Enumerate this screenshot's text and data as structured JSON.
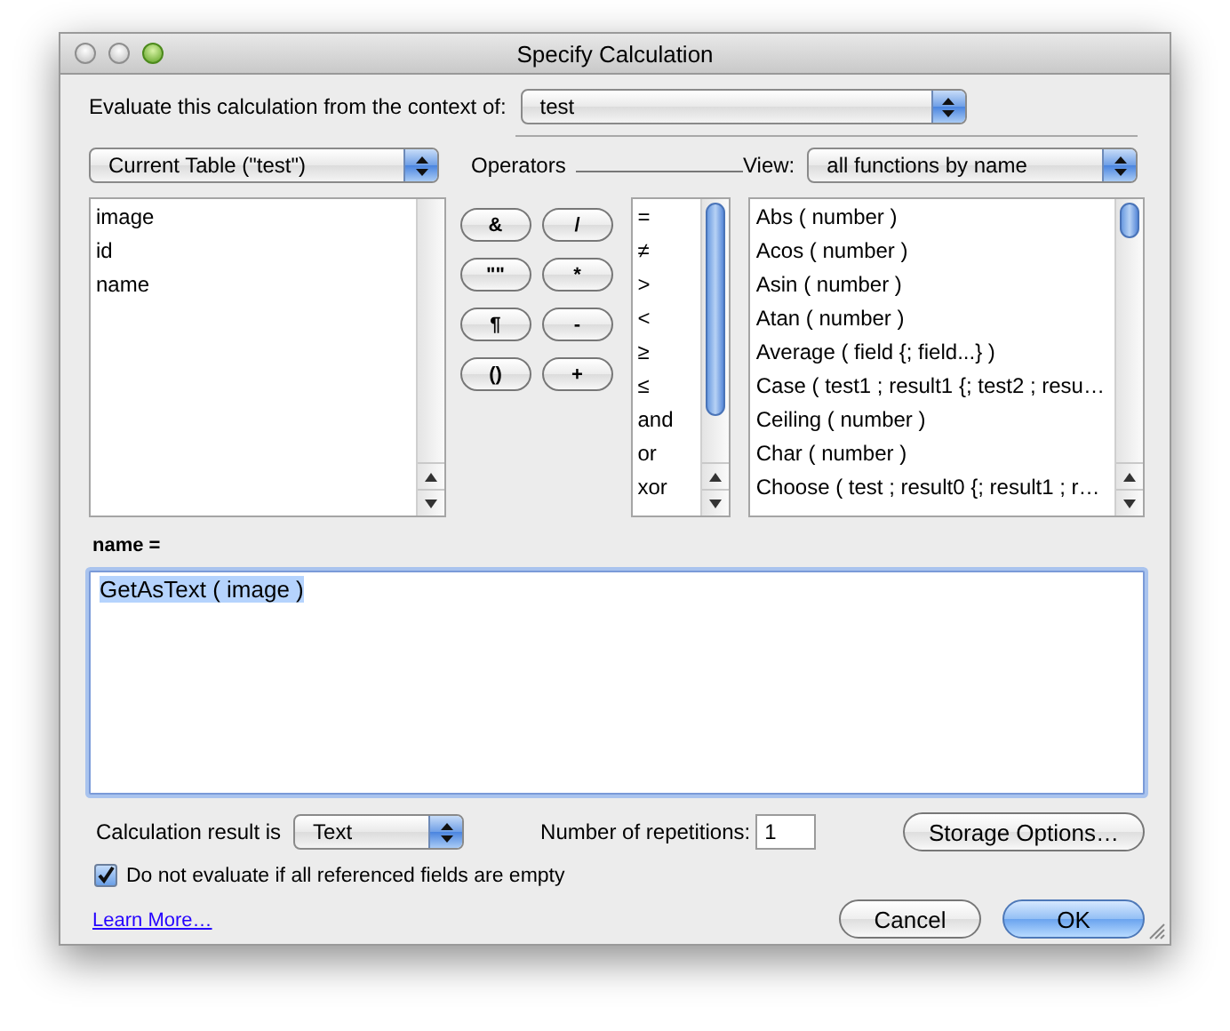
{
  "window": {
    "title": "Specify Calculation"
  },
  "context": {
    "label": "Evaluate this calculation from the context of:",
    "value": "test"
  },
  "table_popup": {
    "value": "Current Table (\"test\")"
  },
  "fields": [
    "image",
    "id",
    "name"
  ],
  "operators": {
    "label": "Operators",
    "buttons": [
      "&",
      "/",
      "\"\"",
      "*",
      "¶",
      "-",
      "()",
      "+"
    ],
    "list": [
      "=",
      "≠",
      ">",
      "<",
      "≥",
      "≤",
      "and",
      "or",
      "xor"
    ]
  },
  "view": {
    "label": "View:",
    "value": "all functions by name"
  },
  "functions": [
    "Abs ( number )",
    "Acos ( number )",
    "Asin ( number )",
    "Atan ( number )",
    "Average ( field {; field...} )",
    "Case ( test1 ; result1 {; test2 ; resu…",
    "Ceiling ( number )",
    "Char ( number )",
    "Choose ( test ; result0 {; result1 ; r…"
  ],
  "formula": {
    "label": "name =",
    "value": "GetAsText ( image )",
    "text_selected": true
  },
  "result": {
    "label": "Calculation result is",
    "value": "Text"
  },
  "repetitions": {
    "label": "Number of repetitions:",
    "value": "1"
  },
  "storage_button": "Storage Options…",
  "do_not_evaluate": {
    "label": "Do not evaluate if all referenced fields are empty",
    "checked": true
  },
  "learn_more": "Learn More…",
  "buttons": [
    {
      "label": "Cancel",
      "default": false
    },
    {
      "label": "OK",
      "default": true
    }
  ]
}
